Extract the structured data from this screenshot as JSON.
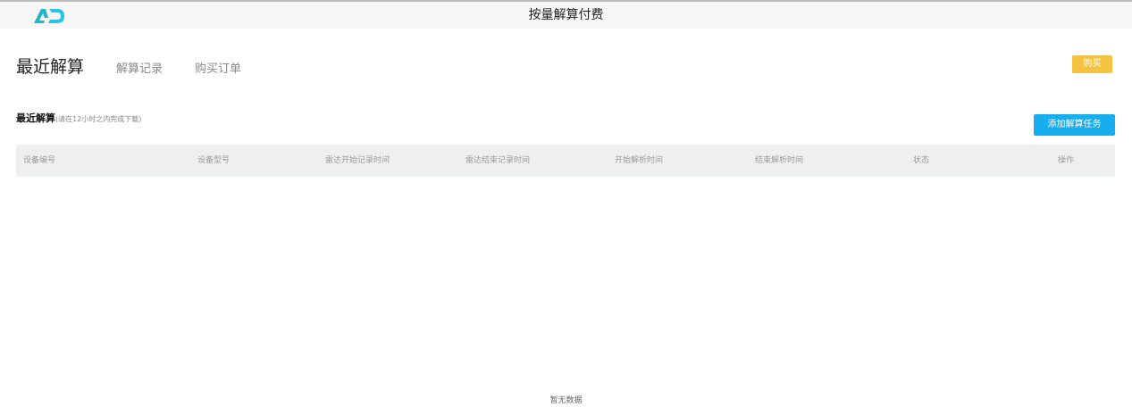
{
  "app": {
    "title": "按量解算付费",
    "logo_text": "AD",
    "logo_icon": "ad-logo-icon"
  },
  "tabs": [
    {
      "label": "最近解算",
      "active": true
    },
    {
      "label": "解算记录",
      "active": false
    },
    {
      "label": "购买订单",
      "active": false
    }
  ],
  "toolbar": {
    "buy_label": "购买"
  },
  "section": {
    "title": "最近解算",
    "note": "(请在12小时之内完成下载)",
    "add_task_label": "添加解算任务"
  },
  "table": {
    "columns": [
      "设备编号",
      "设备型号",
      "雷达开始记录时间",
      "雷达结束记录时间",
      "开始解析时间",
      "结束解析时间",
      "状态",
      "操作"
    ],
    "rows": [],
    "empty_text": "暂无数据"
  },
  "colors": {
    "buy_button": "#f5c242",
    "add_button": "#17aef0",
    "logo_primary": "#1fb6c5",
    "logo_secondary": "#27c6e6"
  }
}
